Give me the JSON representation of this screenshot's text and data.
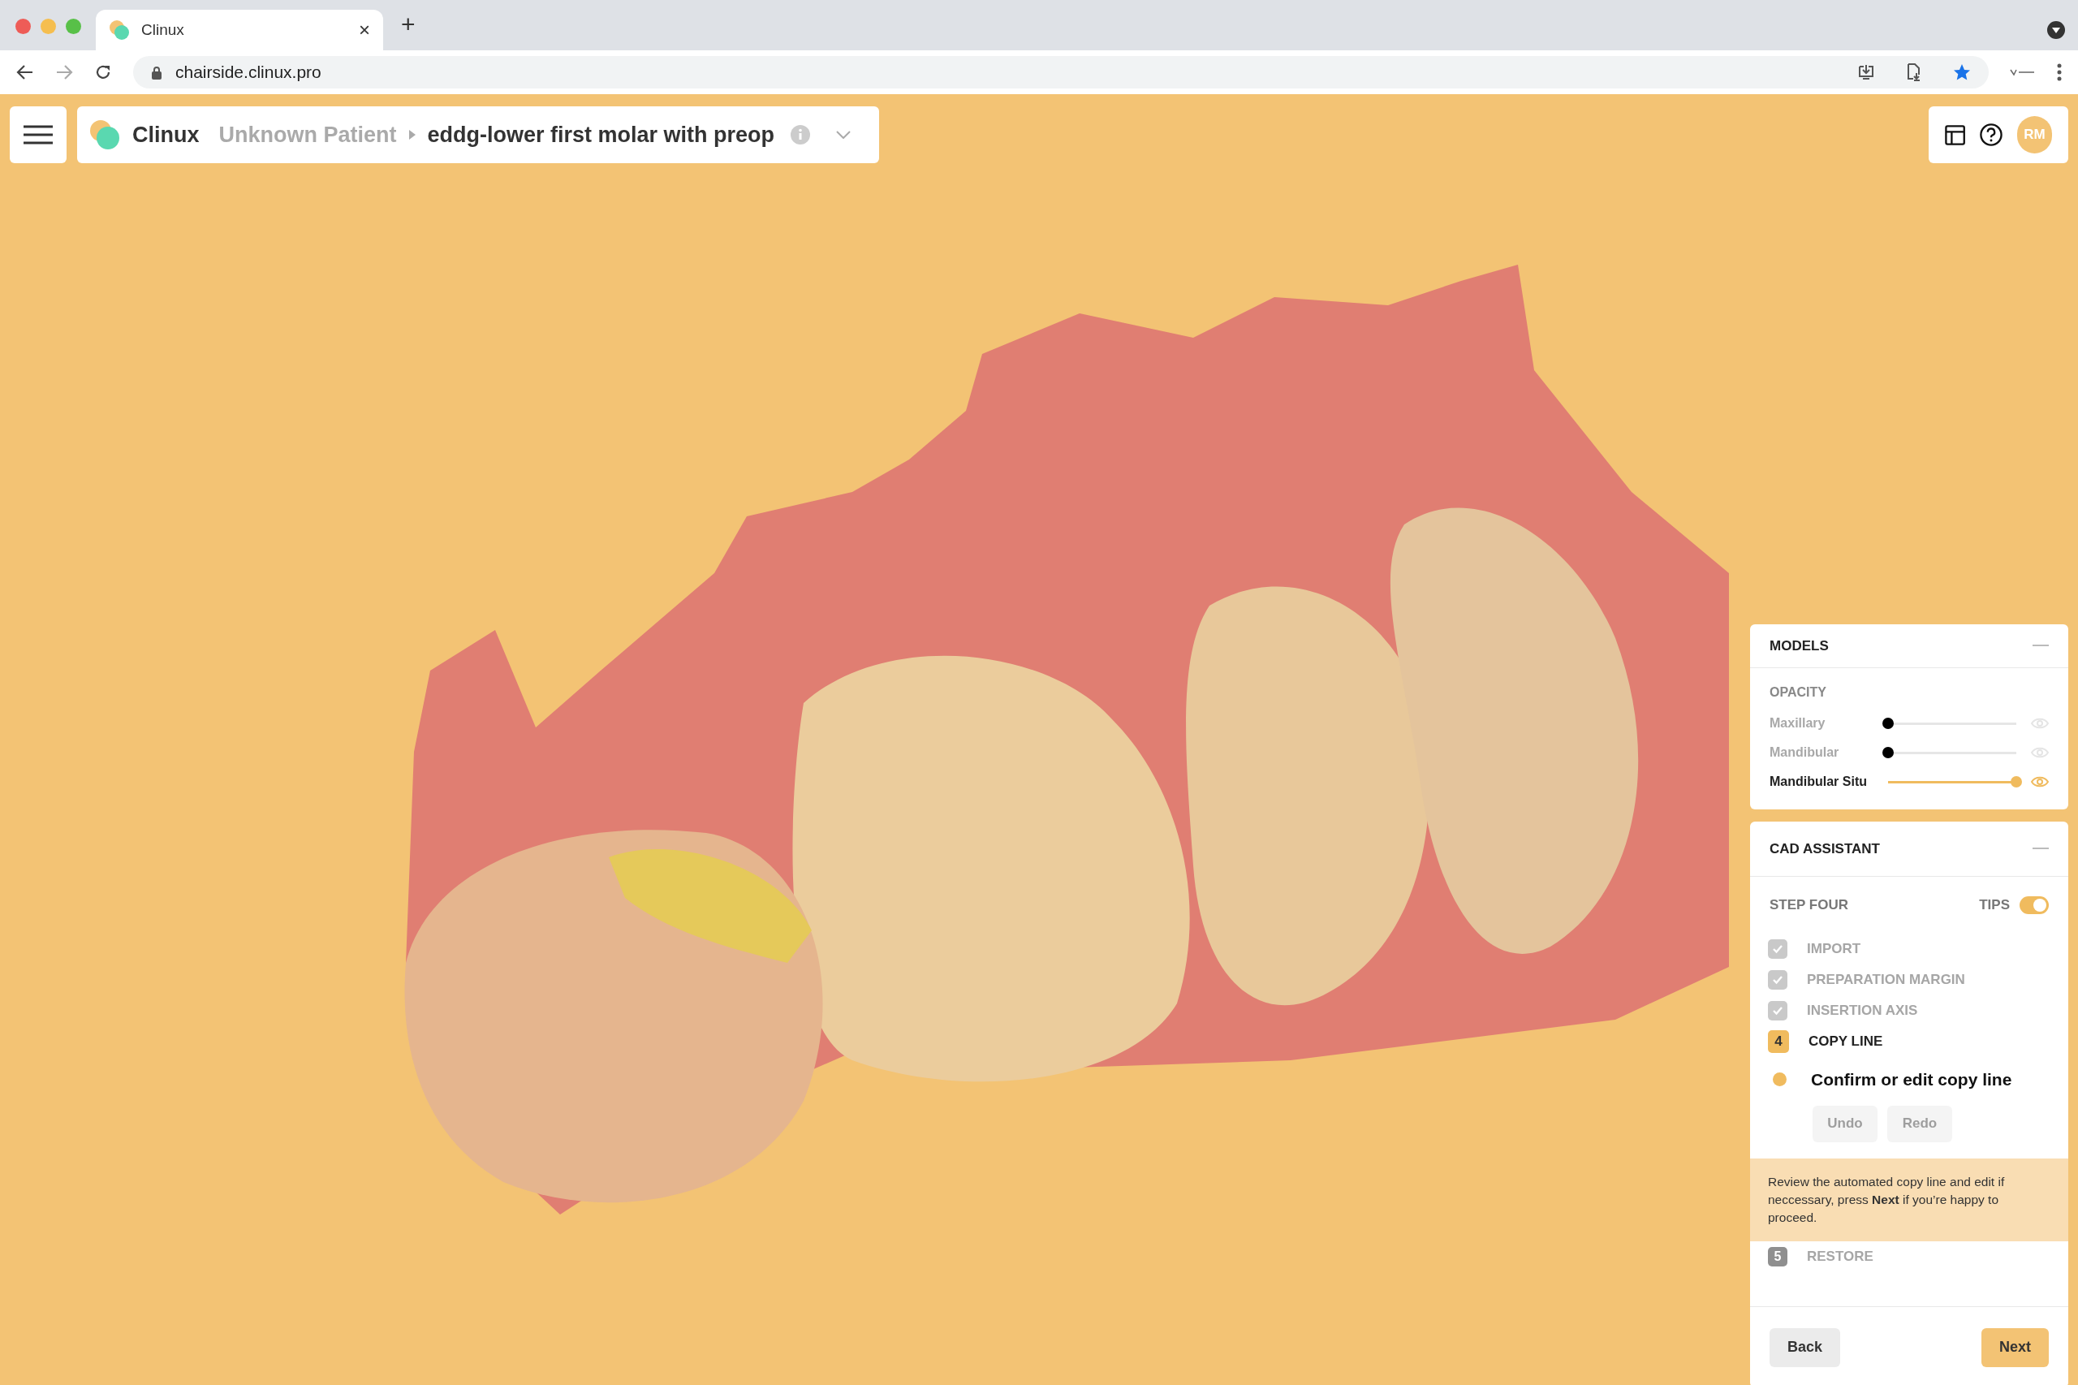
{
  "browser": {
    "tab_title": "Clinux",
    "tab_close": "×",
    "new_tab": "+",
    "url": "chairside.clinux.pro"
  },
  "header": {
    "brand": "Clinux",
    "patient": "Unknown Patient",
    "case": "eddg-lower first molar with preop",
    "avatar": "RM"
  },
  "models": {
    "title": "MODELS",
    "section": "OPACITY",
    "items": [
      {
        "name": "Maxillary",
        "level": 0,
        "visible": false
      },
      {
        "name": "Mandibular",
        "level": 0,
        "visible": false
      },
      {
        "name": "Mandibular Situ",
        "level": 1,
        "visible": true
      }
    ]
  },
  "cad_assistant": {
    "title": "CAD ASSISTANT",
    "step_label": "STEP FOUR",
    "tips_label": "TIPS",
    "tips_on": true,
    "steps": [
      {
        "kind": "done",
        "label": "IMPORT"
      },
      {
        "kind": "done",
        "label": "PREPARATION MARGIN"
      },
      {
        "kind": "done",
        "label": "INSERTION AXIS"
      },
      {
        "kind": "current",
        "number": "4",
        "label": "COPY LINE",
        "task": "Confirm or edit copy line",
        "actions": [
          {
            "label": "Undo",
            "disabled": true
          },
          {
            "label": "Redo",
            "disabled": true
          }
        ],
        "tip": "Review the automated copy line and edit if neccessary, press **Next** if you’re happy to proceed."
      },
      {
        "kind": "pending",
        "number": "5",
        "label": "RESTORE"
      }
    ],
    "buttons": [
      {
        "label": "Back",
        "primary": false
      },
      {
        "label": "Next",
        "primary": true
      }
    ]
  }
}
